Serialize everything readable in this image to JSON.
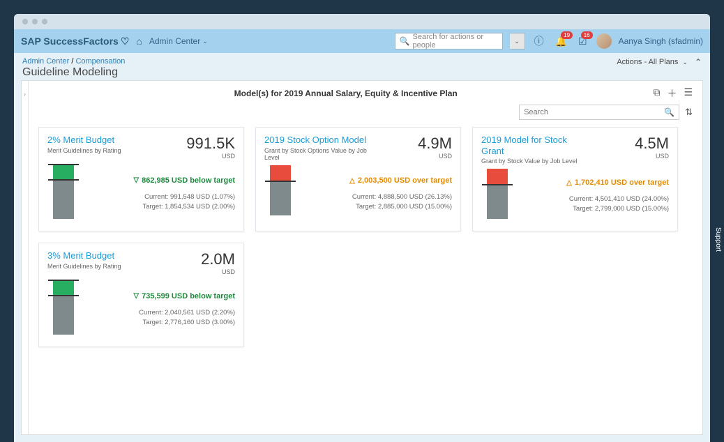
{
  "topbar": {
    "product": "SAP SuccessFactors",
    "nav_link": "Admin Center",
    "search_placeholder": "Search for actions or people",
    "badge1": "19",
    "badge2": "16",
    "user": "Aanya Singh (sfadmin)"
  },
  "breadcrumb": {
    "crumb1": "Admin Center",
    "sep": " / ",
    "crumb2": "Compensation",
    "title": "Guideline Modeling",
    "actions": "Actions - All Plans"
  },
  "panel": {
    "title": "Model(s) for 2019 Annual Salary, Equity & Incentive Plan",
    "search_placeholder": "Search"
  },
  "cards": [
    {
      "title": "2% Merit Budget",
      "sub": "Merit Guidelines by Rating",
      "value": "991.5K",
      "currency": "USD",
      "delta_type": "below",
      "delta_text": "862,985 USD below target",
      "current": "Current: 991,548 USD (1.07%)",
      "target": "Target: 1,854,534 USD (2.00%)",
      "bar_color": "green",
      "top_h": 20,
      "gray_h": 55
    },
    {
      "title": "2019 Stock Option Model",
      "sub": "Grant by Stock Options Value by Job Level",
      "value": "4.9M",
      "currency": "USD",
      "delta_type": "over",
      "delta_text": "2,003,500 USD over target",
      "current": "Current: 4,888,500 USD (26.13%)",
      "target": "Target: 2,885,000 USD (15.00%)",
      "bar_color": "red",
      "top_h": 22,
      "gray_h": 48
    },
    {
      "title": "2019 Model for Stock Grant",
      "sub": "Grant by Stock Value by Job Level",
      "value": "4.5M",
      "currency": "USD",
      "delta_type": "over",
      "delta_text": "1,702,410 USD over target",
      "current": "Current: 4,501,410 USD (24.00%)",
      "target": "Target: 2,799,000 USD (15.00%)",
      "bar_color": "red",
      "top_h": 22,
      "gray_h": 48
    },
    {
      "title": "3% Merit Budget",
      "sub": "Merit Guidelines by Rating",
      "value": "2.0M",
      "currency": "USD",
      "delta_type": "below",
      "delta_text": "735,599 USD below target",
      "current": "Current: 2,040,561 USD (2.20%)",
      "target": "Target: 2,776,160 USD (3.00%)",
      "bar_color": "green",
      "top_h": 20,
      "gray_h": 55
    }
  ],
  "support": "Support"
}
